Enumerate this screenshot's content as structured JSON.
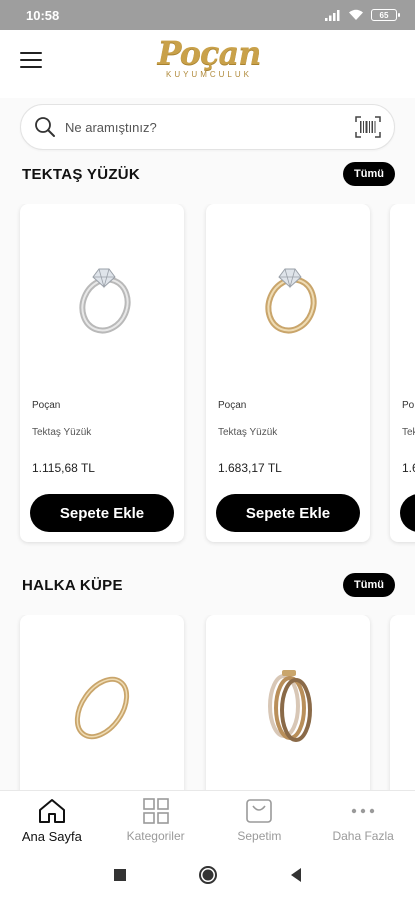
{
  "status_bar": {
    "time": "10:58",
    "battery": "65"
  },
  "header": {
    "logo_text": "Poçan",
    "logo_subtitle": "KUYUMCULUK",
    "brand_color": "#c9a14a"
  },
  "search": {
    "placeholder": "Ne aramıştınız?"
  },
  "sections": [
    {
      "title": "TEKTAŞ YÜZÜK",
      "all_label": "Tümü",
      "products": [
        {
          "brand": "Poçan",
          "name": "Tektaş Yüzük",
          "price": "1.115,68 TL",
          "button": "Sepete Ekle",
          "metal": "white"
        },
        {
          "brand": "Poçan",
          "name": "Tektaş Yüzük",
          "price": "1.683,17 TL",
          "button": "Sepete Ekle",
          "metal": "gold"
        },
        {
          "brand": "Po",
          "name": "Tek",
          "price": "1.6"
        }
      ]
    },
    {
      "title": "HALKA KÜPE",
      "all_label": "Tümü",
      "products": [
        {
          "metal": "gold"
        },
        {
          "metal": "tricolor"
        }
      ]
    }
  ],
  "bottom_nav": [
    {
      "label": "Ana Sayfa",
      "icon": "home-icon",
      "active": true
    },
    {
      "label": "Kategoriler",
      "icon": "grid-icon",
      "active": false
    },
    {
      "label": "Sepetim",
      "icon": "bag-icon",
      "active": false
    },
    {
      "label": "Daha Fazla",
      "icon": "more-icon",
      "active": false
    }
  ],
  "colors": {
    "accent": "#000000",
    "gold": "#c9a14a",
    "status_bar": "#9e9e9e"
  }
}
